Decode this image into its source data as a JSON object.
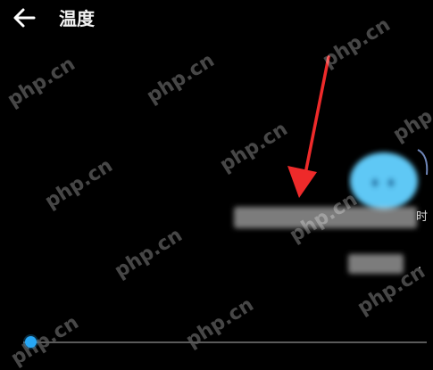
{
  "header": {
    "back_icon": "arrow-left-icon",
    "title": "温度"
  },
  "watermark": {
    "text": "php.cn"
  },
  "annotation": {
    "color": "#ee2a2a",
    "icon": "red-arrow-annotation"
  },
  "content": {
    "edge_char": "时",
    "edge_dot": ".",
    "accent_color": "#5ec8f5"
  },
  "slider": {
    "value": 0.02,
    "accent_color": "#27a7f5"
  }
}
